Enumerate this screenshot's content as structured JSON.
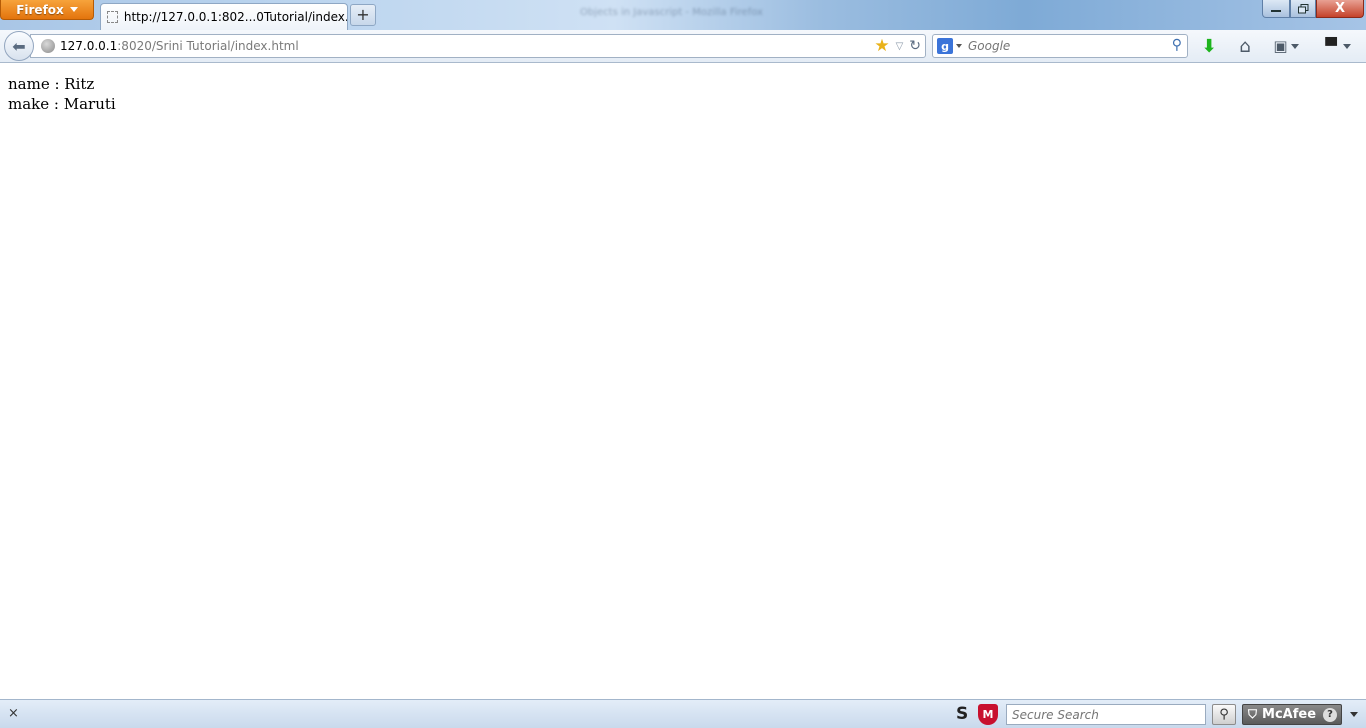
{
  "browser": {
    "menu_button_label": "Firefox",
    "window_title": "Objects in Javascript - Mozilla Firefox"
  },
  "tabs": [
    {
      "title": "http://127.0.0.1:802...0Tutorial/index.html",
      "active": true
    }
  ],
  "new_tab_label": "+",
  "window_controls": {
    "close_label": "X"
  },
  "address_bar": {
    "host": "127.0.0.1",
    "rest": ":8020/Srini Tutorial/index.html"
  },
  "search_bar": {
    "engine_letter": "g",
    "placeholder": "Google"
  },
  "toolbar_icons": [
    "download-icon",
    "home-icon",
    "bookmarks-icon",
    "addon-icon"
  ],
  "page": {
    "lines": [
      "name : Ritz",
      "make : Maruti"
    ]
  },
  "status_bar": {
    "close_label": "×",
    "s_label": "S",
    "shield_letter": "M",
    "secure_search_placeholder": "Secure Search",
    "mcafee_label": "McAfee",
    "help_label": "?"
  },
  "colors": {
    "firefox_orange": "#e3740d",
    "download_green": "#1db41d",
    "mcafee_red": "#c8102e"
  }
}
